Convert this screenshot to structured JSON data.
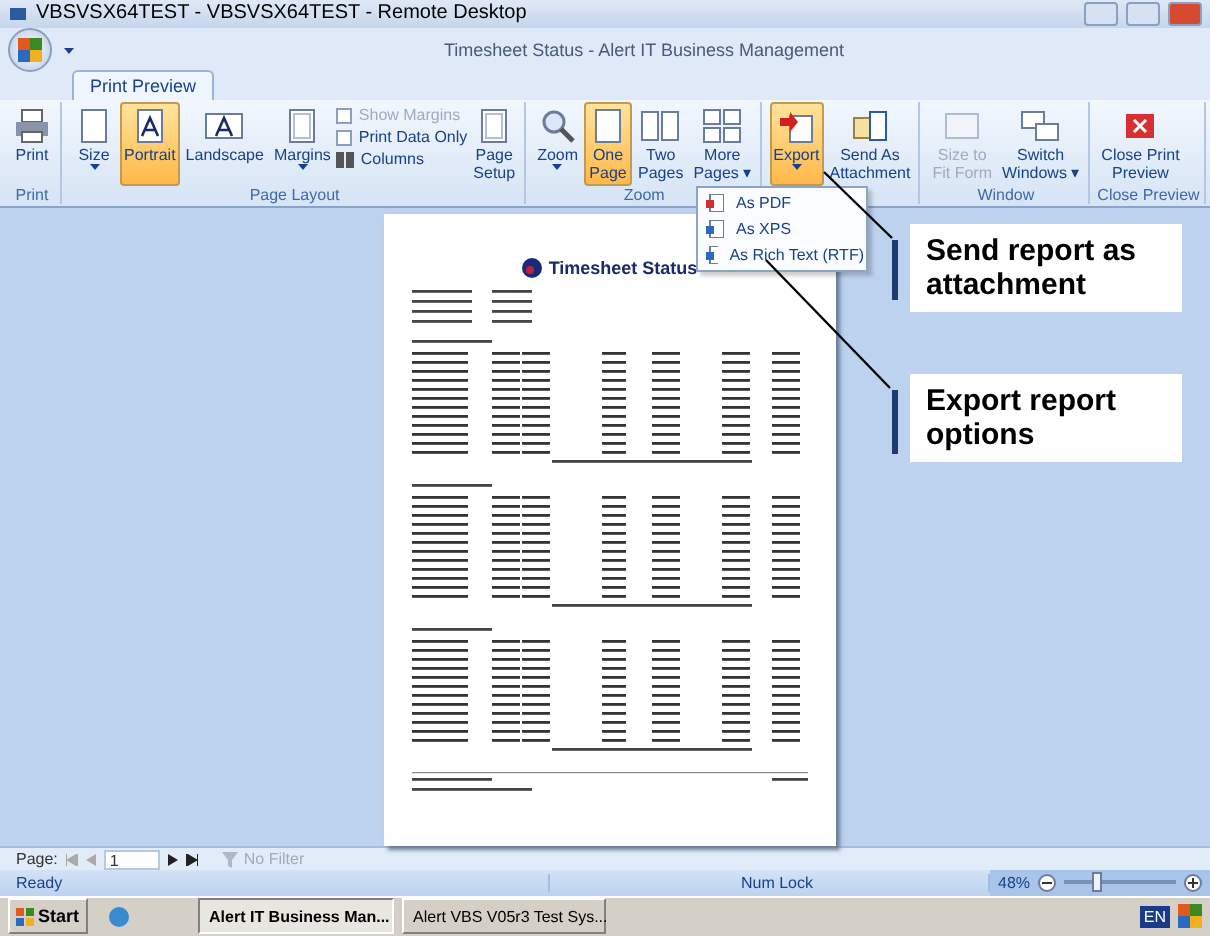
{
  "window": {
    "title": "VBSVSX64TEST - VBSVSX64TEST - Remote Desktop"
  },
  "app": {
    "title": "Timesheet Status - Alert IT Business Management"
  },
  "tabs": [
    {
      "label": "Print Preview",
      "selected": true
    }
  ],
  "ribbon": {
    "groups": [
      {
        "label": "Print",
        "items": [
          {
            "kind": "large",
            "label": "Print",
            "selected": false,
            "disabled": false,
            "dropdown": false
          }
        ]
      },
      {
        "label": "Page Layout",
        "items": [
          {
            "kind": "large",
            "label": "Size",
            "selected": false,
            "disabled": false,
            "dropdown": true
          },
          {
            "kind": "large",
            "label": "Portrait",
            "selected": true,
            "disabled": false,
            "dropdown": false
          },
          {
            "kind": "large",
            "label": "Landscape",
            "selected": false,
            "disabled": false,
            "dropdown": false
          },
          {
            "kind": "large",
            "label": "Margins",
            "selected": false,
            "disabled": false,
            "dropdown": true
          },
          {
            "kind": "stack",
            "entries": [
              {
                "kind": "checkbox",
                "label": "Show Margins",
                "checked": false,
                "disabled": true
              },
              {
                "kind": "checkbox",
                "label": "Print Data Only",
                "checked": false,
                "disabled": false
              },
              {
                "kind": "button",
                "label": "Columns"
              }
            ]
          },
          {
            "kind": "large",
            "label": "Page\nSetup",
            "selected": false,
            "disabled": false,
            "dropdown": false
          }
        ]
      },
      {
        "label": "Zoom",
        "items": [
          {
            "kind": "large",
            "label": "Zoom",
            "selected": false,
            "disabled": false,
            "dropdown": true
          },
          {
            "kind": "large",
            "label": "One\nPage",
            "selected": true,
            "disabled": false,
            "dropdown": false
          },
          {
            "kind": "large",
            "label": "Two\nPages",
            "selected": false,
            "disabled": false,
            "dropdown": false
          },
          {
            "kind": "large",
            "label": "More\nPages ▾",
            "selected": false,
            "disabled": false,
            "dropdown": false
          }
        ]
      },
      {
        "items": [
          {
            "kind": "large",
            "label": "Export",
            "selected": true,
            "disabled": false,
            "dropdown": true
          },
          {
            "kind": "large",
            "label": "Send As\nAttachment",
            "selected": false,
            "disabled": false,
            "dropdown": false
          }
        ]
      },
      {
        "label": "Window",
        "items": [
          {
            "kind": "large",
            "label": "Size to\nFit Form",
            "selected": false,
            "disabled": true,
            "dropdown": false
          },
          {
            "kind": "large",
            "label": "Switch\nWindows ▾",
            "selected": false,
            "disabled": false,
            "dropdown": false
          }
        ]
      },
      {
        "label": "Close Preview",
        "items": [
          {
            "kind": "large",
            "label": "Close Print\nPreview",
            "selected": false,
            "disabled": false,
            "dropdown": false
          }
        ]
      }
    ]
  },
  "export_menu": [
    "As PDF",
    "As XPS",
    "As Rich Text (RTF)"
  ],
  "report": {
    "title": "Timesheet Status"
  },
  "callouts": [
    "Send report as attachment",
    "Export report options"
  ],
  "page_nav": {
    "label": "Page:",
    "value": "1",
    "filter": "No Filter"
  },
  "status_bar": {
    "status": "Ready",
    "num_lock": "Num Lock",
    "zoom": "48%",
    "level": 0.28
  },
  "taskbar": {
    "start": "Start",
    "tasks": [
      {
        "label": "Alert IT Business Man...",
        "selected": true
      },
      {
        "label": "Alert VBS V05r3 Test Sys...",
        "selected": false
      }
    ],
    "tray": "EN"
  }
}
